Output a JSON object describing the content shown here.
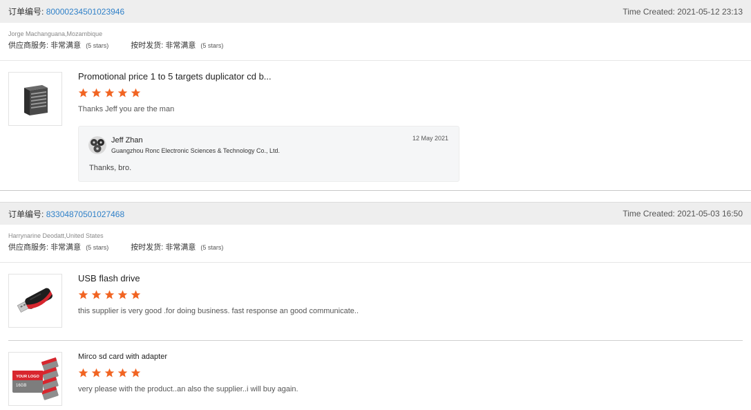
{
  "labels": {
    "order_number": "订单编号:",
    "supplier_service": "供应商服务:",
    "on_time_shipment": "按时发货:",
    "time_created": "Time Created:"
  },
  "colors": {
    "accent_link": "#2f80c8",
    "star": "#f16422",
    "header_bg": "#eeeeee"
  },
  "orders": [
    {
      "order_id": "80000234501023946",
      "time_created": "2021-05-12 23:13",
      "buyer": "Jorge Machanguana,Mozambique",
      "supplier_service_value": "非常满意",
      "supplier_service_stars": "(5 stars)",
      "on_time_value": "非常满意",
      "on_time_stars": "(5 stars)",
      "items": [
        {
          "thumb_icon": "cd-duplicator-tower-icon",
          "title": "Promotional price 1 to 5 targets duplicator cd b...",
          "rating": 5,
          "review": "Thanks Jeff you are the man",
          "reply": {
            "avatar_icon": "supplier-avatar",
            "name": "Jeff Zhan",
            "company": "Guangzhou Ronc Electronic Sciences & Technology Co., Ltd.",
            "date": "12 May 2021",
            "text": "Thanks, bro."
          }
        }
      ]
    },
    {
      "order_id": "83304870501027468",
      "time_created": "2021-05-03 16:50",
      "buyer": "Harrynarine Deodatt,United States",
      "supplier_service_value": "非常满意",
      "supplier_service_stars": "(5 stars)",
      "on_time_value": "非常满意",
      "on_time_stars": "(5 stars)",
      "items": [
        {
          "thumb_icon": "usb-flash-drive-icon",
          "title": "USB flash drive",
          "rating": 5,
          "review": "this supplier is very good .for doing business. fast response an good communicate.."
        },
        {
          "thumb_icon": "sd-card-adapter-icon",
          "title": "Mirco sd card with adapter",
          "rating": 5,
          "review": "very please with the product..an also the supplier..i will buy again.",
          "thumb_text": {
            "logo": "YOUR LOGO",
            "capacity": "16GB"
          }
        }
      ]
    }
  ]
}
